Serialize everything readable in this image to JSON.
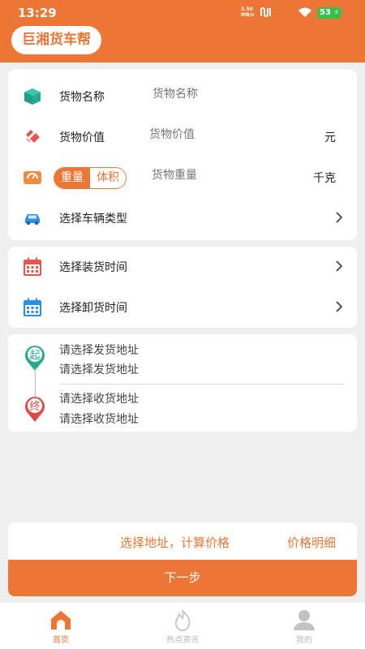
{
  "status_bar": {
    "time": "13:29",
    "net_speed_value": "3.50",
    "net_speed_unit": "MB/s",
    "battery": "53"
  },
  "app": {
    "title": "巨湘货车帮"
  },
  "cargo": {
    "name_label": "货物名称",
    "name_placeholder": "货物名称",
    "value_label": "货物价值",
    "value_placeholder": "货物价值",
    "value_unit": "元",
    "weight_toggle": {
      "weight": "重量",
      "volume": "体积",
      "selected": "weight"
    },
    "weight_placeholder": "货物重量",
    "weight_unit": "千克",
    "vehicle_label": "选择车辆类型"
  },
  "schedule": {
    "load_label": "选择装货时间",
    "unload_label": "选择卸货时间"
  },
  "address": {
    "start_badge": "起",
    "start_title": "请选择发货地址",
    "start_sub": "请选择发货地址",
    "end_badge": "终",
    "end_title": "请选择收货地址",
    "end_sub": "请选择收货地址"
  },
  "price": {
    "calc_text": "选择地址，计算价格",
    "detail_link": "价格明细"
  },
  "actions": {
    "next_button": "下一步"
  },
  "tabbar": {
    "items": [
      {
        "label": "首页",
        "icon": "home-icon",
        "active": true
      },
      {
        "label": "热点资讯",
        "icon": "flame-icon",
        "active": false
      },
      {
        "label": "我的",
        "icon": "user-icon",
        "active": false
      }
    ]
  },
  "colors": {
    "accent": "#ec7634",
    "background": "#efefef",
    "teal": "#26a991",
    "calendar_red": "#e5574b",
    "calendar_blue": "#2b8fe0",
    "pin_red": "#e34848"
  }
}
